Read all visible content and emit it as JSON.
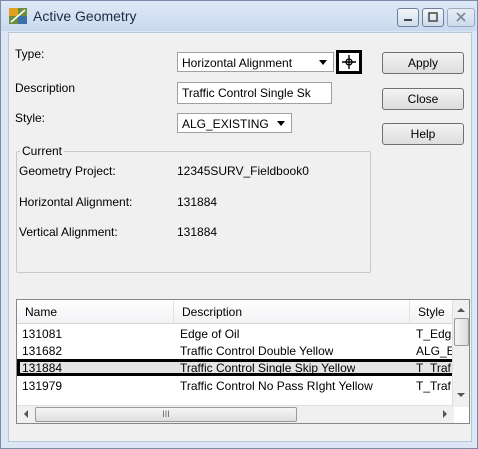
{
  "window": {
    "title": "Active Geometry"
  },
  "form": {
    "type_label": "Type:",
    "type_value": "Horizontal Alignment",
    "description_label": "Description",
    "description_value": "Traffic Control Single Sk",
    "style_label": "Style:",
    "style_value": "ALG_EXISTING"
  },
  "buttons": {
    "apply": "Apply",
    "close": "Close",
    "help": "Help"
  },
  "current": {
    "title": "Current",
    "geometry_project_label": "Geometry Project:",
    "geometry_project_value": "12345SURV_Fieldbook0",
    "horizontal_alignment_label": "Horizontal Alignment:",
    "horizontal_alignment_value": "131884",
    "vertical_alignment_label": "Vertical Alignment:",
    "vertical_alignment_value": "131884"
  },
  "list": {
    "columns": [
      "Name",
      "Description",
      "Style"
    ],
    "rows": [
      {
        "name": "131081",
        "description": "Edge of Oil",
        "style": "T_Edg"
      },
      {
        "name": "131682",
        "description": "Traffic Control Double Yellow",
        "style": "ALG_E"
      },
      {
        "name": "131884",
        "description": "Traffic Control Single Skip Yellow",
        "style": "T_Traf"
      },
      {
        "name": "131979",
        "description": "Traffic Control No Pass RIght Yellow",
        "style": "T_Traf"
      }
    ],
    "selected_row": 2,
    "scroll_thumb_glyph": "III"
  },
  "colors": {
    "selection_outline": "#000000",
    "titlebar": "#c9d9ee",
    "accent": "#3a6ea5"
  }
}
